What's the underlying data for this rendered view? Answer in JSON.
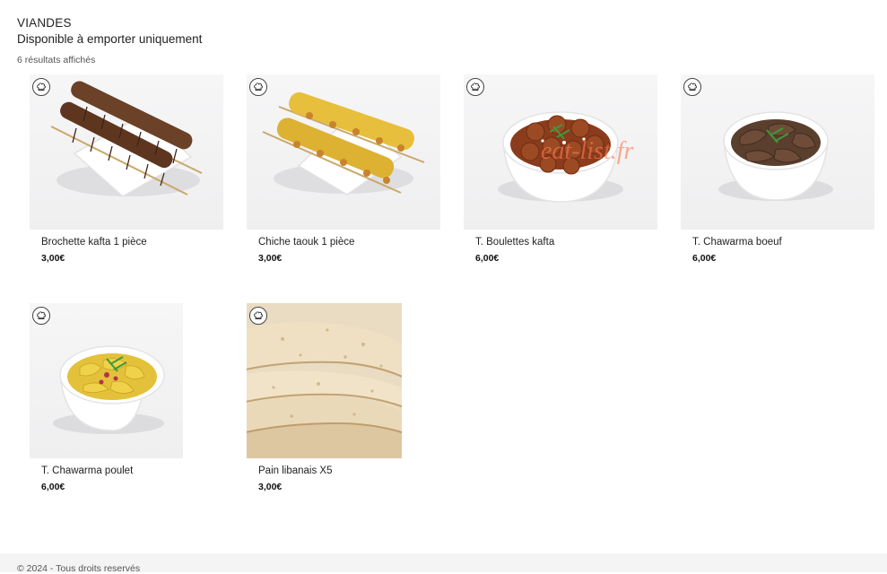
{
  "category": {
    "title": "VIANDES",
    "subtitle": "Disponible à emporter uniquement",
    "results_count": "6 résultats affichés"
  },
  "products": [
    {
      "name": "Brochette kafta 1 pièce",
      "price": "3,00€",
      "image_icon": "kafta-skewers-image"
    },
    {
      "name": "Chiche taouk 1 pièce",
      "price": "3,00€",
      "image_icon": "chicken-skewers-image"
    },
    {
      "name": "T. Boulettes kafta",
      "price": "6,00€",
      "image_icon": "meatball-bowl-image"
    },
    {
      "name": "T. Chawarma boeuf",
      "price": "6,00€",
      "image_icon": "beef-bowl-image"
    },
    {
      "name": "T. Chawarma poulet",
      "price": "6,00€",
      "image_icon": "chicken-bowl-image"
    },
    {
      "name": "Pain libanais X5",
      "price": "3,00€",
      "image_icon": "flatbread-image"
    }
  ],
  "watermark": "eat-list.fr",
  "footer": {
    "text": "© 2024 - Tous droits reservés"
  }
}
